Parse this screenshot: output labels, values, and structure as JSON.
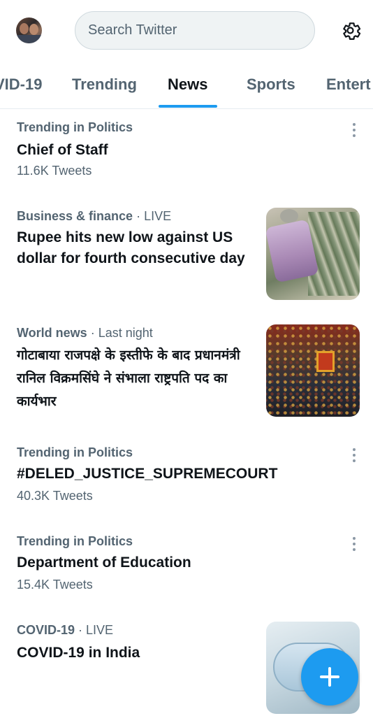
{
  "search": {
    "placeholder": "Search Twitter"
  },
  "tabs": [
    {
      "label": "VID-19"
    },
    {
      "label": "Trending"
    },
    {
      "label": "News",
      "active": true
    },
    {
      "label": "Sports"
    },
    {
      "label": "Entert"
    }
  ],
  "feed": [
    {
      "category": "Trending in Politics",
      "meta_extra": "",
      "headline": "Chief of Staff",
      "sub": "11.6K Tweets"
    },
    {
      "category": "Business & finance",
      "meta_extra": "· LIVE",
      "headline": "Rupee hits new low against US dollar for fourth consecutive day",
      "sub": ""
    },
    {
      "category": "World news",
      "meta_extra": "· Last night",
      "headline": "गोटाबाया राजपक्षे के इस्तीफे के बाद प्रधानमंत्री रानिल विक्रमसिंघे ने संभाला राष्ट्रपति पद का कार्यभार",
      "sub": ""
    },
    {
      "category": "Trending in Politics",
      "meta_extra": "",
      "headline": "#DELED_JUSTICE_SUPREMECOURT",
      "sub": "40.3K Tweets"
    },
    {
      "category": "Trending in Politics",
      "meta_extra": "",
      "headline": "Department of Education",
      "sub": "15.4K Tweets"
    },
    {
      "category": "COVID-19",
      "meta_extra": "· LIVE",
      "headline": "COVID-19 in India",
      "sub": ""
    }
  ],
  "icons": {
    "avatar": "profile-avatar",
    "settings": "gear-icon",
    "more": "more-vertical-icon",
    "compose": "plus-icon"
  },
  "colors": {
    "accent": "#1d9bf0",
    "text": "#0f1419",
    "secondary": "#536471"
  }
}
